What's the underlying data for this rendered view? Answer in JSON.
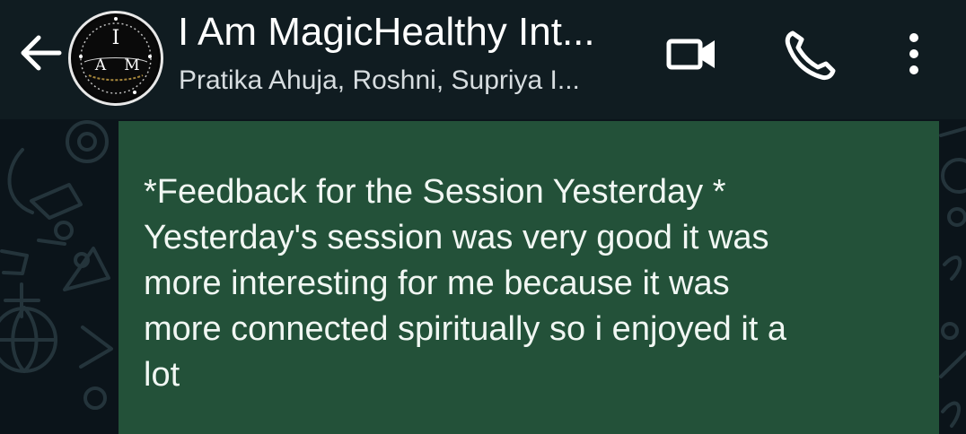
{
  "header": {
    "title": "I Am MagicHealthy Int...",
    "participants": "Pratika Ahuja, Roshni, Supriya I...",
    "avatar_letters": [
      "I",
      "A",
      "M"
    ]
  },
  "icons": {
    "back": "arrow-left-icon",
    "video": "video-camera-icon",
    "call": "phone-icon",
    "more": "more-vertical-icon"
  },
  "message": {
    "text": "*Feedback for the Session Yesterday *\nYesterday's session was very good it was\nmore interesting for me because it was\nmore connected spiritually so i enjoyed it a\nlot"
  },
  "colors": {
    "header_bg": "#101c21",
    "chat_bg": "#0b141a",
    "outgoing_bubble": "#235139",
    "text": "#f1f7f3"
  }
}
